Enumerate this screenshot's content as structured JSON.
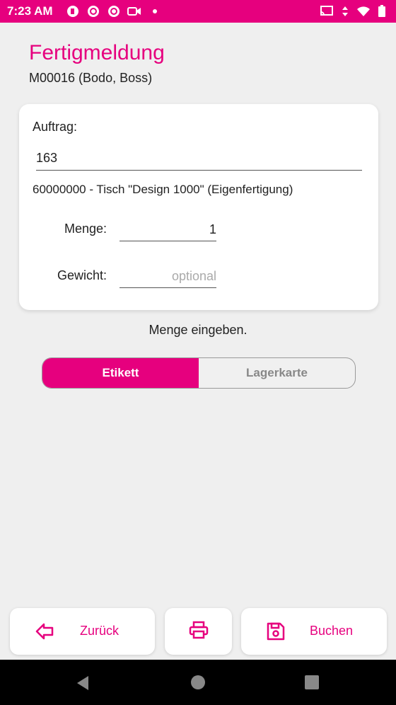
{
  "statusbar": {
    "time": "7:23 AM"
  },
  "header": {
    "title": "Fertigmeldung",
    "subtitle": "M00016 (Bodo, Boss)"
  },
  "card": {
    "auftrag_label": "Auftrag:",
    "auftrag_value": "163",
    "article": "60000000 - Tisch \"Design 1000\" (Eigenfertigung)",
    "menge_label": "Menge:",
    "menge_value": "1",
    "gewicht_label": "Gewicht:",
    "gewicht_placeholder": "optional"
  },
  "hint": "Menge eingeben.",
  "segment": {
    "active": "Etikett",
    "inactive": "Lagerkarte"
  },
  "buttons": {
    "back": "Zurück",
    "save": "Buchen"
  },
  "colors": {
    "accent": "#e6007e",
    "background": "#efefef"
  }
}
